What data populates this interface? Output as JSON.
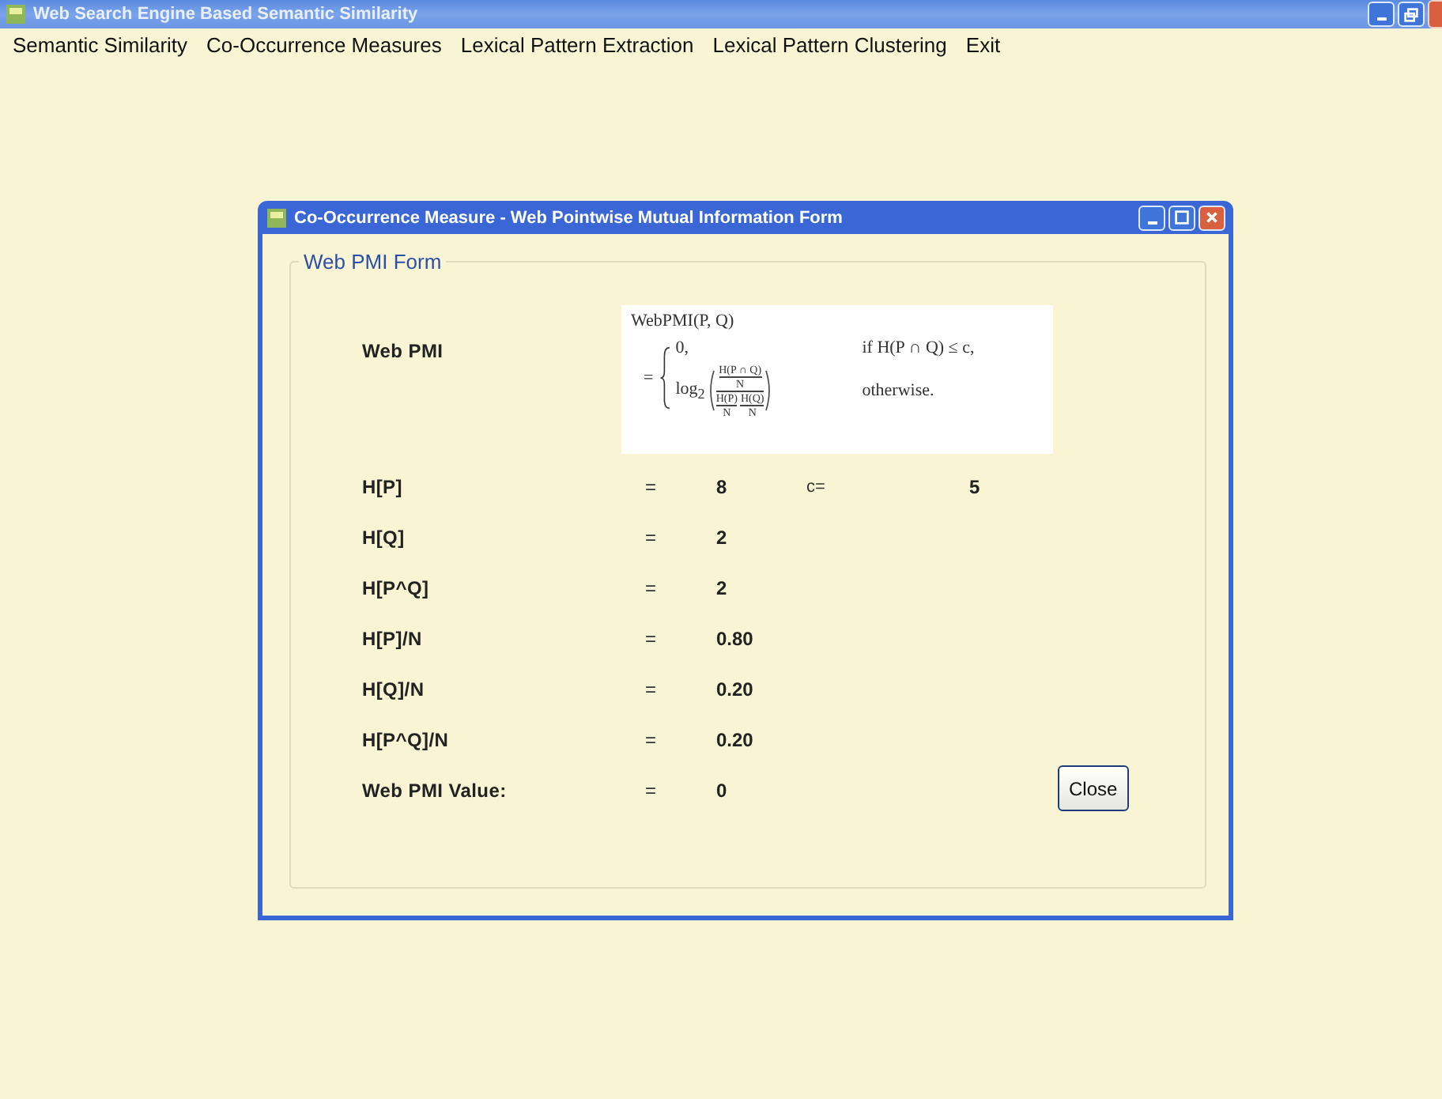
{
  "window": {
    "title": "Web Search Engine Based Semantic Similarity"
  },
  "menu": [
    {
      "label": "Semantic Similarity"
    },
    {
      "label": "Co-Occurrence Measures"
    },
    {
      "label": "Lexical Pattern Extraction"
    },
    {
      "label": "Lexical Pattern Clustering"
    },
    {
      "label": "Exit"
    }
  ],
  "dialog": {
    "title": "Co-Occurrence Measure - Web Pointwise Mutual Information Form",
    "group_title": "Web PMI Form",
    "formula_label": "Web PMI",
    "formula": {
      "lhs": "WebPMI(P, Q)",
      "equals": "=",
      "case1_value": "0,",
      "case1_condition": "if H(P ∩ Q) ≤ c,",
      "log": "log$_{2}$",
      "num_top": "H(P ∩ Q)",
      "num_bottom": "N",
      "den_1_top": "H(P)",
      "den_1_bottom": "N",
      "den_2_top": "H(Q)",
      "den_2_bottom": "N",
      "case2_condition": "otherwise."
    },
    "rows": [
      {
        "label": "H[P]",
        "eq": "=",
        "value": "8",
        "extra_label": "c=",
        "extra_value": "5"
      },
      {
        "label": "H[Q]",
        "eq": "=",
        "value": "2"
      },
      {
        "label": "H[P^Q]",
        "eq": "=",
        "value": "2"
      },
      {
        "label": "H[P]/N",
        "eq": "=",
        "value": "0.80"
      },
      {
        "label": "H[Q]/N",
        "eq": "=",
        "value": "0.20"
      },
      {
        "label": "H[P^Q]/N",
        "eq": "=",
        "value": "0.20"
      },
      {
        "label": "Web PMI Value:",
        "eq": "=",
        "value": "0"
      }
    ],
    "close_button": "Close"
  }
}
